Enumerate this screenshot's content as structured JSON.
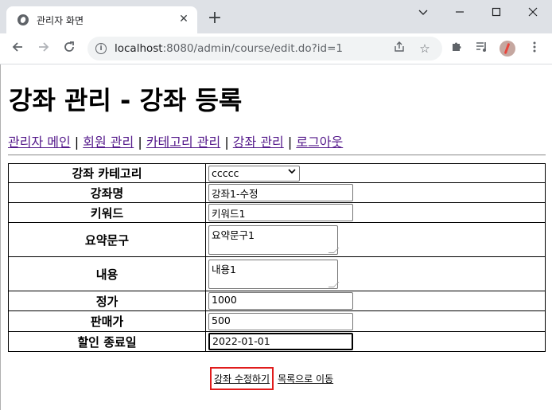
{
  "browser": {
    "tab_title": "관리자 화면",
    "new_tab_label": "+",
    "url_host": "localhost",
    "url_rest": ":8080/admin/course/edit.do?id=1"
  },
  "page": {
    "heading": "강좌 관리 - 강좌 등록",
    "nav": [
      {
        "label": "관리자 메인"
      },
      {
        "label": "회원 관리"
      },
      {
        "label": "카테고리 관리"
      },
      {
        "label": "강좌 관리"
      },
      {
        "label": "로그아웃"
      }
    ],
    "separator": "|",
    "form": {
      "category_label": "강좌 카테고리",
      "category_value": "ccccc",
      "name_label": "강좌명",
      "name_value": "강좌1-수정",
      "keyword_label": "키워드",
      "keyword_value": "키워드1",
      "summary_label": "요약문구",
      "summary_value": "요약문구1",
      "content_label": "내용",
      "content_value": "내용1",
      "price_label": "정가",
      "price_value": "1000",
      "sale_price_label": "판매가",
      "sale_price_value": "500",
      "sale_end_label": "할인 종료일",
      "sale_end_value": "2022-01-01"
    },
    "submit_label": "강좌 수정하기",
    "back_label": "목록으로 이동"
  },
  "colors": {
    "highlight": "#e01c1c",
    "visited_link": "#551a8b",
    "chrome_bg": "#dee1e6"
  }
}
